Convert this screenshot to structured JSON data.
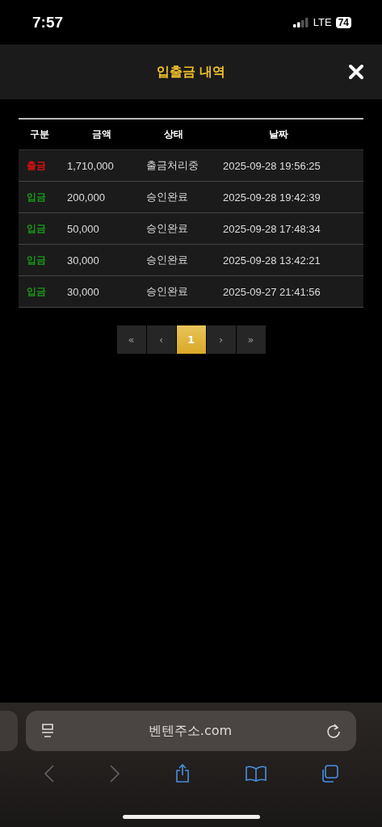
{
  "status_bar": {
    "time": "7:57",
    "network": "LTE",
    "battery": "74"
  },
  "header": {
    "title": "입출금 내역"
  },
  "table": {
    "columns": [
      "구분",
      "금액",
      "상태",
      "날짜"
    ],
    "rows": [
      {
        "kind": "withdrawal",
        "type": "출금",
        "amount": "1,710,000",
        "status": "출금처리중",
        "date": "2025-09-28 19:56:25"
      },
      {
        "kind": "deposit",
        "type": "입금",
        "amount": "200,000",
        "status": "승인완료",
        "date": "2025-09-28 19:42:39"
      },
      {
        "kind": "deposit",
        "type": "입금",
        "amount": "50,000",
        "status": "승인완료",
        "date": "2025-09-28 17:48:34"
      },
      {
        "kind": "deposit",
        "type": "입금",
        "amount": "30,000",
        "status": "승인완료",
        "date": "2025-09-28 13:42:21"
      },
      {
        "kind": "deposit",
        "type": "입금",
        "amount": "30,000",
        "status": "승인완료",
        "date": "2025-09-27 21:41:56"
      }
    ]
  },
  "pagination": [
    {
      "label": "«",
      "selected": false
    },
    {
      "label": "‹",
      "selected": false
    },
    {
      "label": "1",
      "selected": true
    },
    {
      "label": "›",
      "selected": false
    },
    {
      "label": "»",
      "selected": false
    }
  ],
  "browser": {
    "address": "벤텐주소.com"
  }
}
